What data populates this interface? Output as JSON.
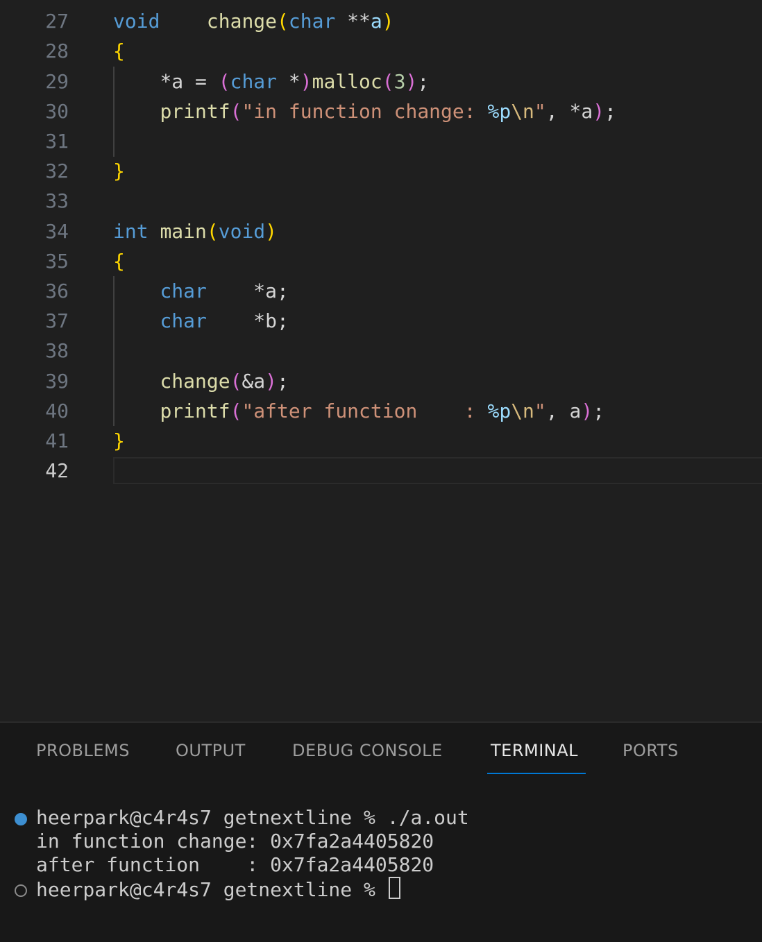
{
  "editor": {
    "line_numbers": [
      "27",
      "28",
      "29",
      "30",
      "31",
      "32",
      "33",
      "34",
      "35",
      "36",
      "37",
      "38",
      "39",
      "40",
      "41",
      "42"
    ],
    "active_line": "42",
    "tokens": {
      "l27_void": "void",
      "l27_fn": "change",
      "l27_paren_open": "(",
      "l27_char": "char",
      "l27_ptr": " **",
      "l27_a": "a",
      "l27_paren_close": ")",
      "l28_brace": "{",
      "l29_a": "*a = ",
      "l29_paren_open": "(",
      "l29_char": "char",
      "l29_ptr": " *",
      "l29_paren_close": ")",
      "l29_fn": "malloc",
      "l29_p2o": "(",
      "l29_num": "3",
      "l29_p2c": ")",
      "l29_semi": ";",
      "l30_fn": "printf",
      "l30_po": "(",
      "l30_str": "\"in function change: ",
      "l30_fmt": "%p",
      "l30_esc": "\\n",
      "l30_strend": "\"",
      "l30_rest": ", *a",
      "l30_pc": ")",
      "l30_semi": ";",
      "l32_brace": "}",
      "l34_int": "int",
      "l34_fn": "main",
      "l34_po": "(",
      "l34_void": "void",
      "l34_pc": ")",
      "l35_brace": "{",
      "l36_char": "char",
      "l36_var": "    *a;",
      "l37_char": "char",
      "l37_var": "    *b;",
      "l39_fn": "change",
      "l39_po": "(",
      "l39_arg": "&a",
      "l39_pc": ")",
      "l39_semi": ";",
      "l40_fn": "printf",
      "l40_po": "(",
      "l40_str": "\"after function    : ",
      "l40_fmt": "%p",
      "l40_esc": "\\n",
      "l40_strend": "\"",
      "l40_rest": ", a",
      "l40_pc": ")",
      "l40_semi": ";",
      "l41_brace": "}"
    }
  },
  "panel": {
    "tabs": [
      {
        "label": "PROBLEMS"
      },
      {
        "label": "OUTPUT"
      },
      {
        "label": "DEBUG CONSOLE"
      },
      {
        "label": "TERMINAL"
      },
      {
        "label": "PORTS"
      }
    ],
    "active_tab": "TERMINAL"
  },
  "terminal": {
    "line1": "heerpark@c4r4s7 getnextline % ./a.out",
    "line2": "in function change: 0x7fa2a4405820",
    "line3": "after function    : 0x7fa2a4405820",
    "line4": "heerpark@c4r4s7 getnextline % "
  },
  "colors": {
    "keyword": "#569cd6",
    "function": "#dcdcaa",
    "string": "#ce9178",
    "bracket_level1": "#ffd700",
    "bracket_level2": "#da70d6",
    "accent": "#0078d4",
    "success_dot": "#3d8fd1"
  }
}
